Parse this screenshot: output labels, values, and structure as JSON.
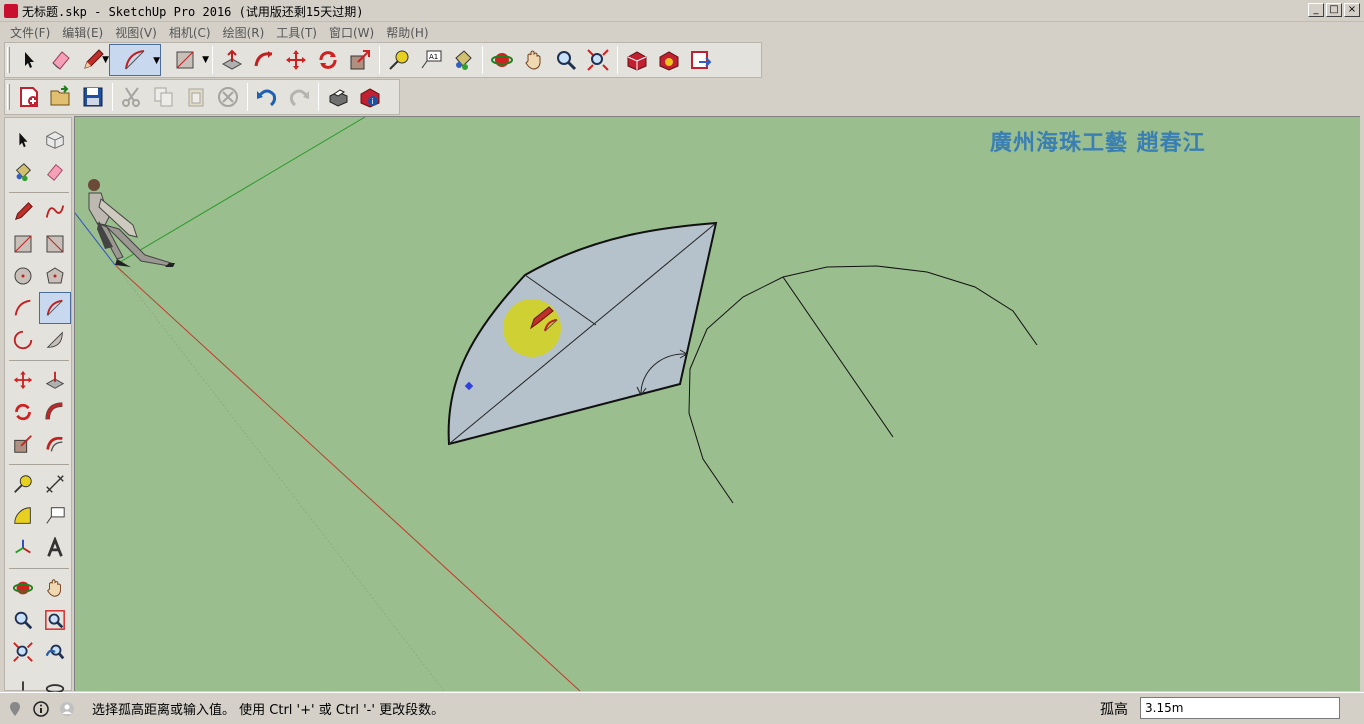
{
  "window": {
    "title": "无标题.skp - SketchUp Pro 2016 (试用版还剩15天过期)",
    "minimize": "_",
    "maximize": "□",
    "close": "×"
  },
  "menu": [
    {
      "label": "文件(F)"
    },
    {
      "label": "编辑(E)"
    },
    {
      "label": "视图(V)"
    },
    {
      "label": "相机(C)"
    },
    {
      "label": "绘图(R)"
    },
    {
      "label": "工具(T)"
    },
    {
      "label": "窗口(W)"
    },
    {
      "label": "帮助(H)"
    }
  ],
  "viewport": {
    "watermark": "廣州海珠工藝  趙春江"
  },
  "status": {
    "hint": "选择孤高距离或输入值。 使用 Ctrl '+' 或 Ctrl '-' 更改段数。",
    "vcb_label": "孤高",
    "vcb_value": "3.15m"
  },
  "colors": {
    "viewport_bg": "#9abe8e",
    "face_fill": "#b5c2cc",
    "red_axis": "#c0392b",
    "green_axis": "#2e9a2e",
    "blue_axis": "#3050c0",
    "watermark": "#3a7fb4",
    "highlight": "#d8d400"
  }
}
